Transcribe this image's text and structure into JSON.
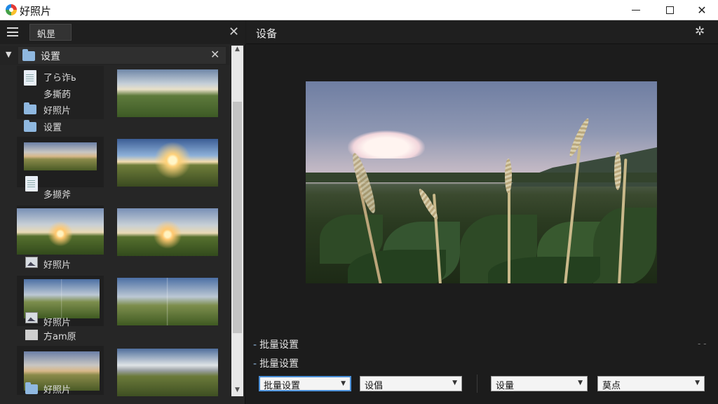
{
  "window": {
    "title": "好照片",
    "minimize": "—",
    "maximize": "□",
    "close": "✕"
  },
  "left_panel": {
    "tab_label": "䖠昰",
    "close": "✕",
    "folder": {
      "label": "设置",
      "close": "✕",
      "caret": "▼"
    },
    "scroll": {
      "up": "▲",
      "down": "▼"
    },
    "grid": [
      {
        "kind": "filelist",
        "rows": [
          {
            "icon": "document-icon",
            "label": "了ら诈ь"
          },
          {
            "icon": "none",
            "label": "多撕菂"
          },
          {
            "icon": "folder-icon",
            "label": "好照片"
          },
          {
            "icon": "folder-icon",
            "label": "设置"
          }
        ]
      },
      {
        "kind": "image",
        "style": "sky1"
      },
      {
        "kind": "image-with-label",
        "style": "sky4",
        "icon": "document-icon",
        "label": "多撷斧"
      },
      {
        "kind": "image",
        "style": "sky2"
      },
      {
        "kind": "image-with-label",
        "style": "sky3",
        "icon": "image-icon",
        "label": "好照片"
      },
      {
        "kind": "image",
        "style": "sky3"
      },
      {
        "kind": "image-with-label",
        "style": "sky5",
        "icon": "landscape-icon",
        "label": "好照片",
        "extra_icon": "square-icon",
        "extra_label": "方am原"
      },
      {
        "kind": "image",
        "style": "sky5"
      },
      {
        "kind": "image-with-label",
        "style": "sky4",
        "icon": "folder-icon",
        "label": "好照片"
      },
      {
        "kind": "image",
        "style": "sky6"
      }
    ]
  },
  "right_panel": {
    "title": "设备",
    "pin": "✲",
    "sections": [
      "批量设置",
      "批量设置"
    ],
    "dots": "- -",
    "dropdowns": [
      {
        "value": "批量设置",
        "active": true
      },
      {
        "value": "设倡",
        "active": false
      },
      {
        "value": "设量",
        "active": false
      },
      {
        "value": "莫点",
        "active": false
      }
    ],
    "dropdown_arrow": "▼"
  }
}
